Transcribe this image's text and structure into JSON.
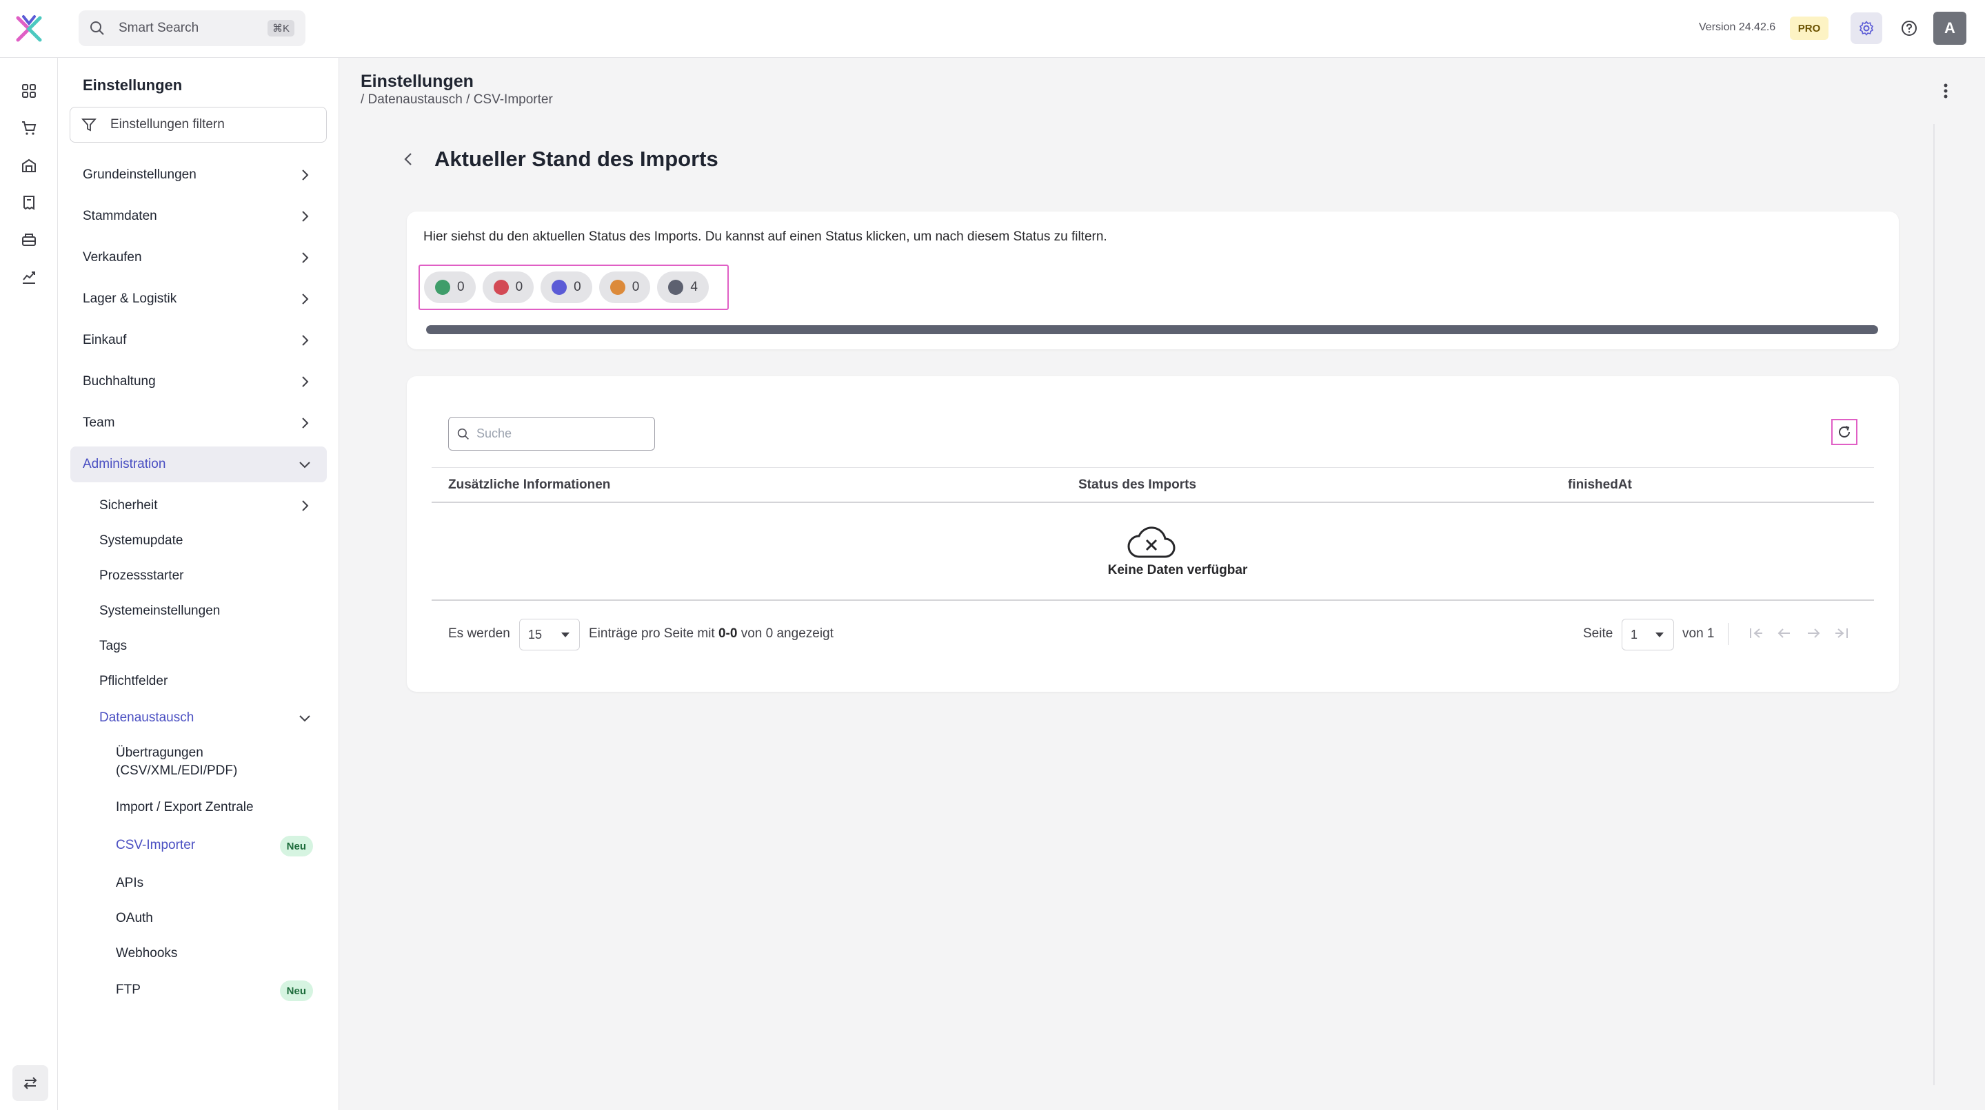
{
  "topbar": {
    "search_label": "Smart Search",
    "search_shortcut": "⌘K",
    "version": "Version 24.42.6",
    "plan_badge": "PRO",
    "avatar_initial": "A"
  },
  "rail": {
    "icons": [
      "dashboard-icon",
      "cart-icon",
      "warehouse-icon",
      "receipt-icon",
      "register-icon",
      "analytics-icon"
    ],
    "bottom_icon": "swap-arrows-icon"
  },
  "sidebar": {
    "title": "Einstellungen",
    "filter_placeholder": "Einstellungen filtern",
    "items": [
      {
        "label": "Grundeinstellungen"
      },
      {
        "label": "Stammdaten"
      },
      {
        "label": "Verkaufen"
      },
      {
        "label": "Lager & Logistik"
      },
      {
        "label": "Einkauf"
      },
      {
        "label": "Buchhaltung"
      },
      {
        "label": "Team"
      },
      {
        "label": "Administration"
      }
    ],
    "admin_children": [
      {
        "label": "Sicherheit"
      },
      {
        "label": "Systemupdate"
      },
      {
        "label": "Prozessstarter"
      },
      {
        "label": "Systemeinstellungen"
      },
      {
        "label": "Tags"
      },
      {
        "label": "Pflichtfelder"
      },
      {
        "label": "Datenaustausch"
      }
    ],
    "datenaustausch_children": [
      {
        "label_line1": "Übertragungen",
        "label_line2": "(CSV/XML/EDI/PDF)"
      },
      {
        "label": "Import / Export Zentrale"
      },
      {
        "label": "CSV-Importer",
        "badge": "Neu"
      },
      {
        "label": "APIs"
      },
      {
        "label": "OAuth"
      },
      {
        "label": "Webhooks"
      },
      {
        "label": "FTP",
        "badge": "Neu"
      }
    ]
  },
  "header": {
    "title": "Einstellungen",
    "breadcrumb": "/ Datenaustausch / CSV-Importer"
  },
  "page": {
    "heading": "Aktueller Stand des Imports",
    "description": "Hier siehst du den aktuellen Status des Imports. Du kannst auf einen Status klicken, um nach diesem Status zu filtern.",
    "status_chips": [
      {
        "color": "#3f9d6a",
        "count": "0"
      },
      {
        "color": "#d34a55",
        "count": "0"
      },
      {
        "color": "#5b5bd6",
        "count": "0"
      },
      {
        "color": "#dc8a3a",
        "count": "0"
      },
      {
        "color": "#5d6170",
        "count": "4"
      }
    ],
    "progress_fraction": 1.0
  },
  "table": {
    "search_placeholder": "Suche",
    "columns": [
      "Zusätzliche Informationen",
      "Status des Imports",
      "finishedAt"
    ],
    "empty_text": "Keine Daten verfügbar",
    "footer": {
      "prefix": "Es werden",
      "page_size": "15",
      "middle": "Einträge pro Seite mit",
      "range": "0-0",
      "suffix": "von 0 angezeigt",
      "page_label": "Seite",
      "page_value": "1",
      "of_label": "von 1"
    }
  },
  "colors": {
    "accent": "#4a4fc2",
    "highlight": "#e05fc5",
    "badge_bg": "#d6f4e1"
  }
}
